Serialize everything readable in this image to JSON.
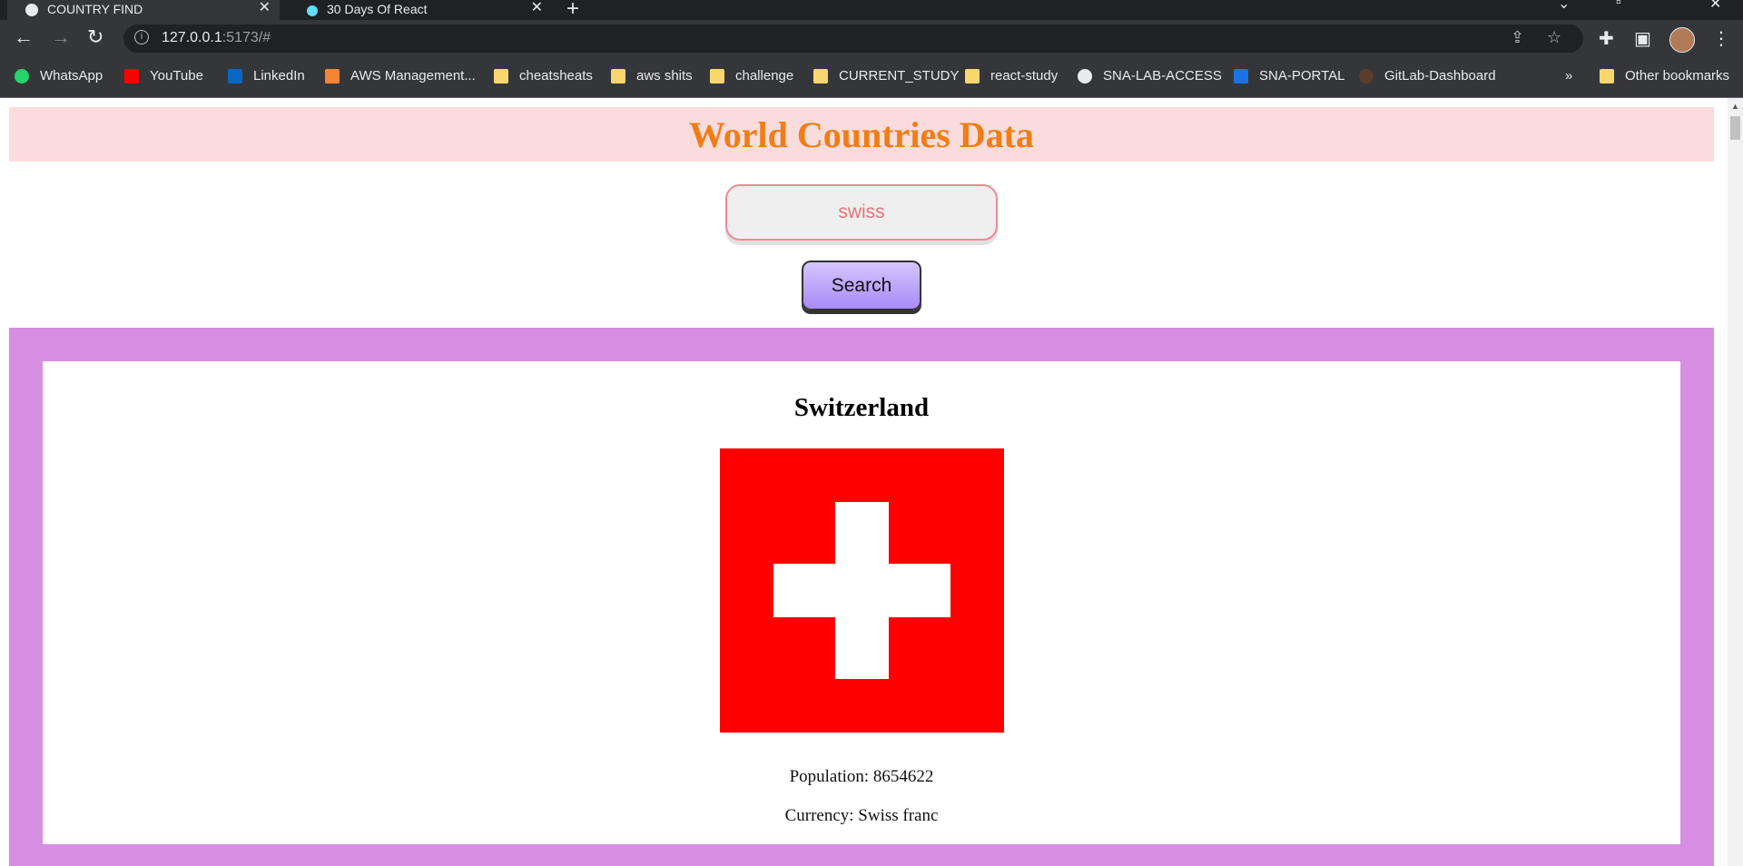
{
  "browser": {
    "tabs": [
      {
        "title": "COUNTRY FIND"
      },
      {
        "title": "30 Days Of React"
      }
    ],
    "url_host": "127.0.0.1",
    "url_rest": ":5173/#",
    "bookmarks": [
      {
        "label": "WhatsApp",
        "icon": "whatsapp-icon",
        "color": "#25d366"
      },
      {
        "label": "YouTube",
        "icon": "youtube-icon",
        "color": "#ff0000"
      },
      {
        "label": "LinkedIn",
        "icon": "linkedin-icon",
        "color": "#0a66c2"
      },
      {
        "label": "AWS Management...",
        "icon": "aws-icon",
        "color": "#f58536"
      },
      {
        "label": "cheatsheats",
        "icon": "folder-icon"
      },
      {
        "label": "aws shits",
        "icon": "folder-icon"
      },
      {
        "label": "challenge",
        "icon": "folder-icon"
      },
      {
        "label": "CURRENT_STUDY",
        "icon": "folder-icon"
      },
      {
        "label": "react-study",
        "icon": "folder-icon"
      },
      {
        "label": "SNA-LAB-ACCESS",
        "icon": "sna-icon"
      },
      {
        "label": "SNA-PORTAL",
        "icon": "portal-icon",
        "color": "#1a73e8"
      },
      {
        "label": "GitLab-Dashboard",
        "icon": "gitlab-icon"
      }
    ],
    "overflow": "»",
    "other_bookmarks": "Other bookmarks"
  },
  "app": {
    "title": "World Countries Data",
    "search": {
      "value": "swiss"
    },
    "search_button": "Search",
    "result": {
      "name": "Switzerland",
      "population_text": "Population: 8654622",
      "currency_text": "Currency: Swiss franc"
    }
  },
  "colors": {
    "header_bg": "#fbdcdd",
    "title": "#f07d16",
    "results_bg": "#d68ee3",
    "flag_red": "#ff0000"
  }
}
